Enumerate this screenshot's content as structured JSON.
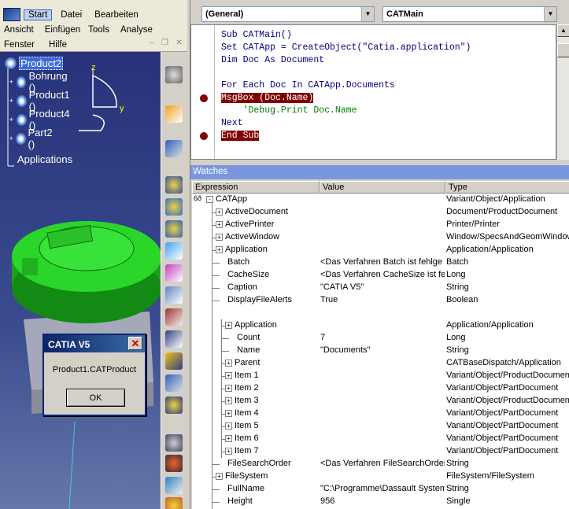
{
  "catia": {
    "menu_row1": [
      "Start",
      "Datei",
      "Bearbeiten"
    ],
    "menu_row2": [
      "Ansicht",
      "Einfügen",
      "Tools",
      "Analyse"
    ],
    "menu_row3": [
      "Fenster",
      "Hilfe"
    ],
    "tree": {
      "root": "Product2",
      "children": [
        "Bohrung ()",
        "Product1 ()",
        "Product4 ()",
        "Part2 ()"
      ],
      "footer": "Applications"
    },
    "axis_z": "z",
    "axis_y": "y"
  },
  "msgbox": {
    "title": "CATIA V5",
    "text": "Product1.CATProduct",
    "ok_label": "OK",
    "close_glyph": "✕"
  },
  "vbe": {
    "object_combo": "(General)",
    "proc_combo": "CATMain",
    "code_lines": [
      {
        "text": "Sub CATMain()",
        "style": "kw"
      },
      {
        "text": "Set CATApp = CreateObject(\"Catia.application\")",
        "style": "kw"
      },
      {
        "text": "Dim Doc As Document",
        "style": "kw"
      },
      {
        "text": "",
        "style": ""
      },
      {
        "text": "For Each Doc In CATApp.Documents",
        "style": "kw"
      },
      {
        "text": "MsgBox (Doc.Name)",
        "style": "bp"
      },
      {
        "text": "    'Debug.Print Doc.Name",
        "style": "cm"
      },
      {
        "text": "Next",
        "style": "kw"
      },
      {
        "text": "End Sub",
        "style": "bp"
      }
    ],
    "watches_title": "Watches",
    "headers": [
      "Expression",
      "Value",
      "Type"
    ],
    "rows": [
      {
        "e": "CATApp",
        "v": "",
        "t": "Variant/Object/Application",
        "lvl": 0,
        "exp": "-"
      },
      {
        "e": "ActiveDocument",
        "v": "",
        "t": "Document/ProductDocument",
        "lvl": 1,
        "exp": "+"
      },
      {
        "e": "ActivePrinter",
        "v": "",
        "t": "Printer/Printer",
        "lvl": 1,
        "exp": "+"
      },
      {
        "e": "ActiveWindow",
        "v": "",
        "t": "Window/SpecsAndGeomWindow",
        "lvl": 1,
        "exp": "+"
      },
      {
        "e": "Application",
        "v": "",
        "t": "Application/Application",
        "lvl": 1,
        "exp": "+"
      },
      {
        "e": "Batch",
        "v": "<Das Verfahren Batch ist fehlge",
        "t": "Batch",
        "lvl": 1,
        "exp": ""
      },
      {
        "e": "CacheSize",
        "v": "<Das Verfahren CacheSize ist fe",
        "t": "Long",
        "lvl": 1,
        "exp": ""
      },
      {
        "e": "Caption",
        "v": "\"CATIA V5\"",
        "t": "String",
        "lvl": 1,
        "exp": ""
      },
      {
        "e": "DisplayFileAlerts",
        "v": "True",
        "t": "Boolean",
        "lvl": 1,
        "exp": ""
      },
      {
        "e": "",
        "v": "",
        "t": "",
        "lvl": 1,
        "exp": ""
      },
      {
        "e": "Application",
        "v": "",
        "t": "Application/Application",
        "lvl": 2,
        "exp": "+"
      },
      {
        "e": "Count",
        "v": "7",
        "t": "Long",
        "lvl": 2,
        "exp": ""
      },
      {
        "e": "Name",
        "v": "\"Documents\"",
        "t": "String",
        "lvl": 2,
        "exp": ""
      },
      {
        "e": "Parent",
        "v": "",
        "t": "CATBaseDispatch/Application",
        "lvl": 2,
        "exp": "+"
      },
      {
        "e": "Item 1",
        "v": "",
        "t": "Variant/Object/ProductDocument",
        "lvl": 2,
        "exp": "+"
      },
      {
        "e": "Item 2",
        "v": "",
        "t": "Variant/Object/PartDocument",
        "lvl": 2,
        "exp": "+"
      },
      {
        "e": "Item 3",
        "v": "",
        "t": "Variant/Object/ProductDocument",
        "lvl": 2,
        "exp": "+"
      },
      {
        "e": "Item 4",
        "v": "",
        "t": "Variant/Object/PartDocument",
        "lvl": 2,
        "exp": "+"
      },
      {
        "e": "Item 5",
        "v": "",
        "t": "Variant/Object/PartDocument",
        "lvl": 2,
        "exp": "+"
      },
      {
        "e": "Item 6",
        "v": "",
        "t": "Variant/Object/PartDocument",
        "lvl": 2,
        "exp": "+"
      },
      {
        "e": "Item 7",
        "v": "",
        "t": "Variant/Object/PartDocument",
        "lvl": 2,
        "exp": "+"
      },
      {
        "e": "FileSearchOrder",
        "v": "<Das Verfahren FileSearchOrder",
        "t": "String",
        "lvl": 1,
        "exp": ""
      },
      {
        "e": "FileSystem",
        "v": "",
        "t": "FileSystem/FileSystem",
        "lvl": 1,
        "exp": "+"
      },
      {
        "e": "FullName",
        "v": "\"C:\\Programme\\Dassault Systeme",
        "t": "String",
        "lvl": 1,
        "exp": ""
      },
      {
        "e": "Height",
        "v": "956",
        "t": "Single",
        "lvl": 1,
        "exp": ""
      }
    ],
    "colors": {
      "breakpoint": "#7f0000",
      "keyword": "#00007f",
      "comment": "#007f00",
      "watch_title": "#7a96df"
    }
  }
}
